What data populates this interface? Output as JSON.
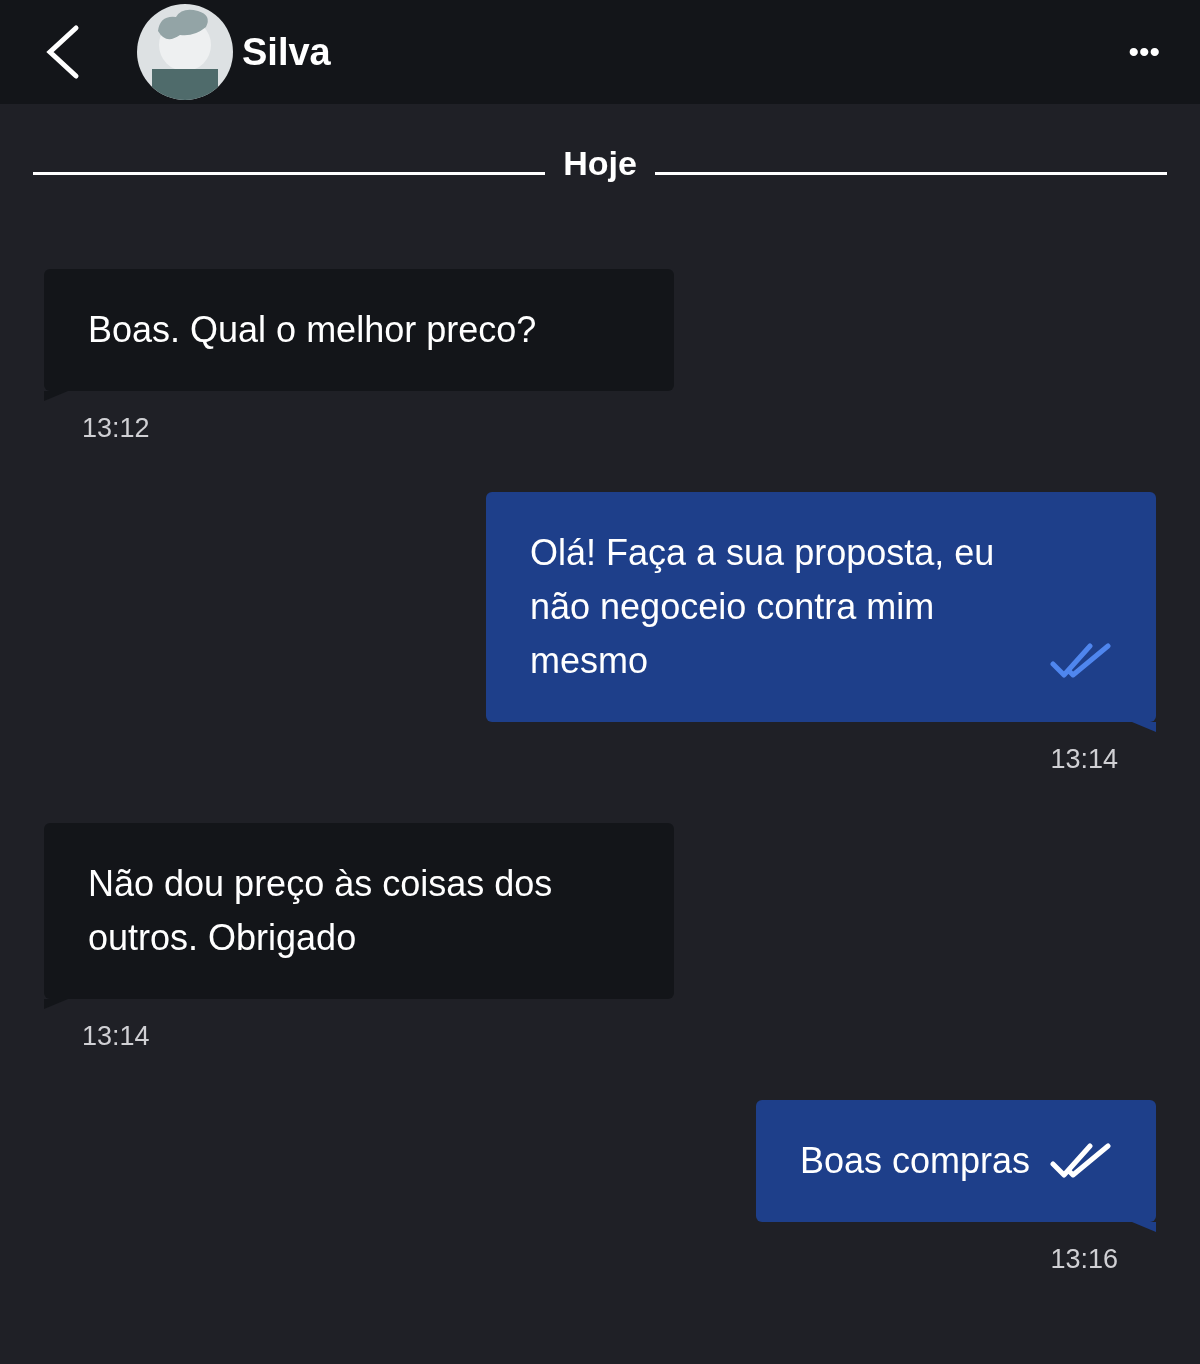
{
  "header": {
    "name": "Silva",
    "menu": "•••"
  },
  "divider": {
    "label": "Hoje"
  },
  "messages": [
    {
      "kind": "incoming",
      "text": "Boas. Qual o melhor preco?",
      "time": "13:12"
    },
    {
      "kind": "outgoing",
      "text": "Olá! Faça a sua proposta, eu não negoceio contra mim mesmo",
      "time": "13:14",
      "read": true
    },
    {
      "kind": "incoming",
      "text": "Não dou preço às coisas dos outros. Obrigado",
      "time": "13:14"
    },
    {
      "kind": "outgoing",
      "text": "Boas compras",
      "time": "13:16",
      "read": false
    }
  ]
}
